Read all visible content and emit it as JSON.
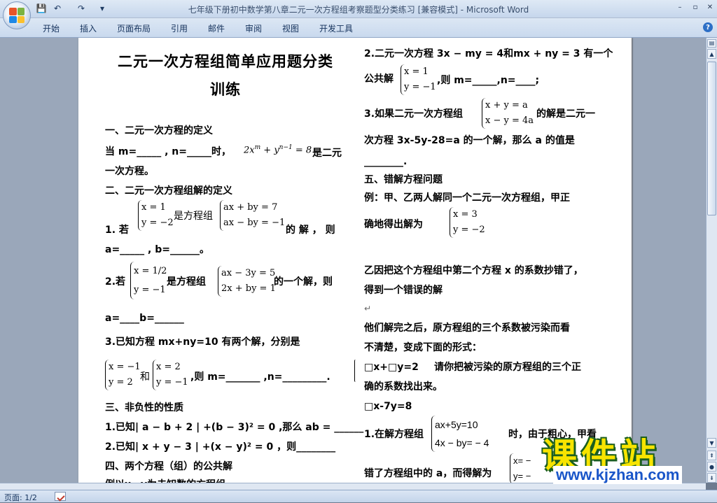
{
  "window": {
    "title": "七年级下册初中数学第八章二元一次方程组考察题型分类练习 [兼容模式]",
    "app": " - Microsoft Word",
    "controls": {
      "minimize": "–",
      "restore": "▫",
      "close": "✕"
    },
    "colors": {
      "ribbon": "#c9d9ee",
      "accent": "#2d6fc6"
    }
  },
  "quick_access": {
    "save": "💾",
    "undo": "↶",
    "redo": "↷",
    "more": "▾"
  },
  "ribbon": {
    "tabs": [
      "开始",
      "插入",
      "页面布局",
      "引用",
      "邮件",
      "审阅",
      "视图",
      "开发工具"
    ],
    "help": "?"
  },
  "status": {
    "page": "页面: 1/2"
  },
  "doc": {
    "title1": "二元一次方程组简单应用题分类",
    "title2": "训练",
    "s1": "一、二元一次方程的定义",
    "s1_q1a": "当 m=_____ , n=_____时，",
    "s1_q1_eq": "2x",
    "s1_q1_b": "是二元",
    "s1_q1c": "一次方程。",
    "s2": "二、二元一次方程组解的定义",
    "q1_sys_a": [
      "x = 1",
      "y = −2"
    ],
    "q1_is": "是方程组",
    "q1_sys_b": [
      "ax + by = 7",
      "ax − by = −1"
    ],
    "q1_pre": "1. 若",
    "q1_post": "的 解 ， 则",
    "q1_line2": "a=_____ , b=______。",
    "q2_pre": "2.若",
    "q2_sys_a": [
      "x = 1/2",
      "y = −1"
    ],
    "q2_mid": "是方程组",
    "q2_sys_b": [
      "ax − 3y = 5",
      "2x + by = 1"
    ],
    "q2_post": "的一个解，则",
    "q2_line2": "a=____b=______",
    "q3": "3.已知方程  mx+ny=10  有两个解，分别是",
    "q3_sys_a": [
      "x = −1",
      "y = 2"
    ],
    "q3_and": "和",
    "q3_sys_b": [
      "x = 2",
      "y = −1"
    ],
    "q3_post": ",则 m=_______ ,n=_________.",
    "s3": "三、非负性的性质",
    "s3_q1": "1.已知| a − b + 2 | +(b − 3)² = 0 ,那么 ab = ______",
    "s3_q2": "2.已知| x + y − 3 | +(x − y)² = 0 ，则________",
    "s4": "四、两个方程（组）的公共解",
    "s4_cut": "例以x，y为未知数的方程组",
    "r_q2a": "2.二元一次方程 3x − my = 4和mx + ny = 3 有一个",
    "r_q2b_pre": "公共解",
    "r_q2_sys": [
      "x = 1",
      "y = −1"
    ],
    "r_q2b_post": ",则 m=_____,n=____;",
    "r_q3_pre": "3.如果二元一次方程组",
    "r_q3_sys": [
      "x + y = a",
      "x − y = 4a"
    ],
    "r_q3_post": "的解是二元一",
    "r_q3_l2": "次方程  3x-5y-28=a  的一个解，那么  a  的值是",
    "r_q3_l3": "________.",
    "s5": "五、错解方程问题",
    "ex1": "例：甲、乙两人解同一个二元一次方程组，甲正",
    "ex2": "确地得出解为",
    "ex_sys": [
      "x = 3",
      "y = −2"
    ],
    "ex3": "乙因把这个方程组中第二个方程 x 的系数抄错了，",
    "ex4": "得到一个错误的解",
    "ex5": "他们解完之后，原方程组的三个系数被污染而看",
    "ex6": "不清楚，变成下面的形式：",
    "ex7a": "□x+□y=2",
    "ex7b": "请你把被污染的原方程组的三个正",
    "ex8": "确的系数找出来。",
    "ex9": "□x-7y=8",
    "r1_pre": "1.在解方程组",
    "r1_sys": [
      "ax+5y=10",
      "4x − by= − 4"
    ],
    "r1_post": "时，由于粗心，甲看",
    "r1_l2": "错了方程组中的 a，而得解为",
    "r1_sys2": [
      "x= −",
      "y= −"
    ],
    "para": "↵"
  },
  "watermark": {
    "cn": "课件站",
    "url": "www.kjzhan.com"
  }
}
